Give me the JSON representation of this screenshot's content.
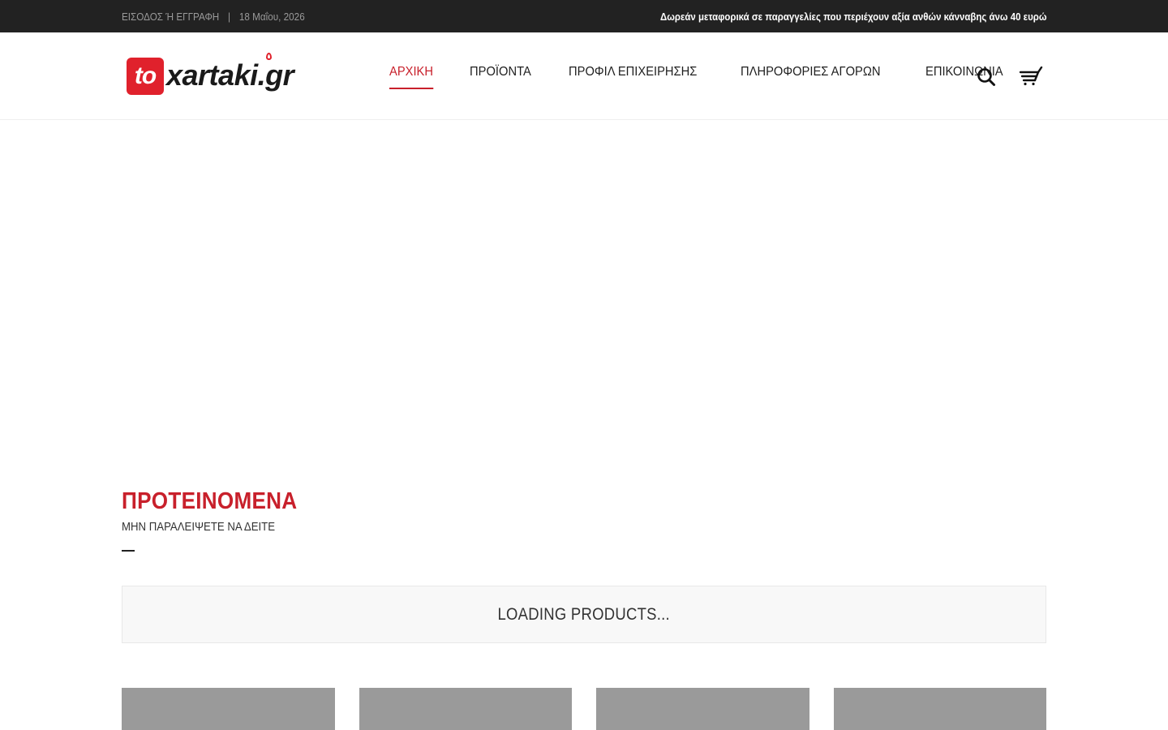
{
  "topbar": {
    "login_label": "ΕΙΣΟΔΟΣ Ή ΕΓΓΡΑΦΗ",
    "separator": "|",
    "date": "18 Μαΐου, 2026",
    "promo": "Δωρεάν μεταφορικά σε παραγγελίες που περιέχουν αξία ανθών κάνναβης άνω 40 ευρώ"
  },
  "logo": {
    "prefix": "to",
    "name": "xartaki.gr"
  },
  "nav": {
    "items": [
      {
        "label": "ΑΡΧΙΚΗ",
        "active": true
      },
      {
        "label": "ΠΡΟΪΟΝΤΑ",
        "active": false
      },
      {
        "label": "ΠΡΟΦΙΛ ΕΠΙΧΕΙΡΗΣΗΣ",
        "active": false
      },
      {
        "label": "ΠΛΗΡΟΦΟΡΙΕΣ ΑΓΟΡΩΝ",
        "active": false
      },
      {
        "label": "ΕΠΙΚΟΙΝΩΝΙΑ",
        "active": false
      }
    ]
  },
  "icons": {
    "search": "search-icon",
    "cart": "cart-icon"
  },
  "featured": {
    "title": "ΠΡΟΤΕΙΝΟΜΕΝΑ",
    "subtitle": "ΜΗΝ ΠΑΡΑΛΕΙΨΕΤΕ ΝΑ ΔΕΙΤΕ",
    "loading_text": "LOADING PRODUCTS..."
  },
  "colors": {
    "accent": "#c8202b",
    "logo_red": "#e0212c",
    "topbar_bg": "#222222",
    "placeholder_gray": "#9a9a9a"
  }
}
